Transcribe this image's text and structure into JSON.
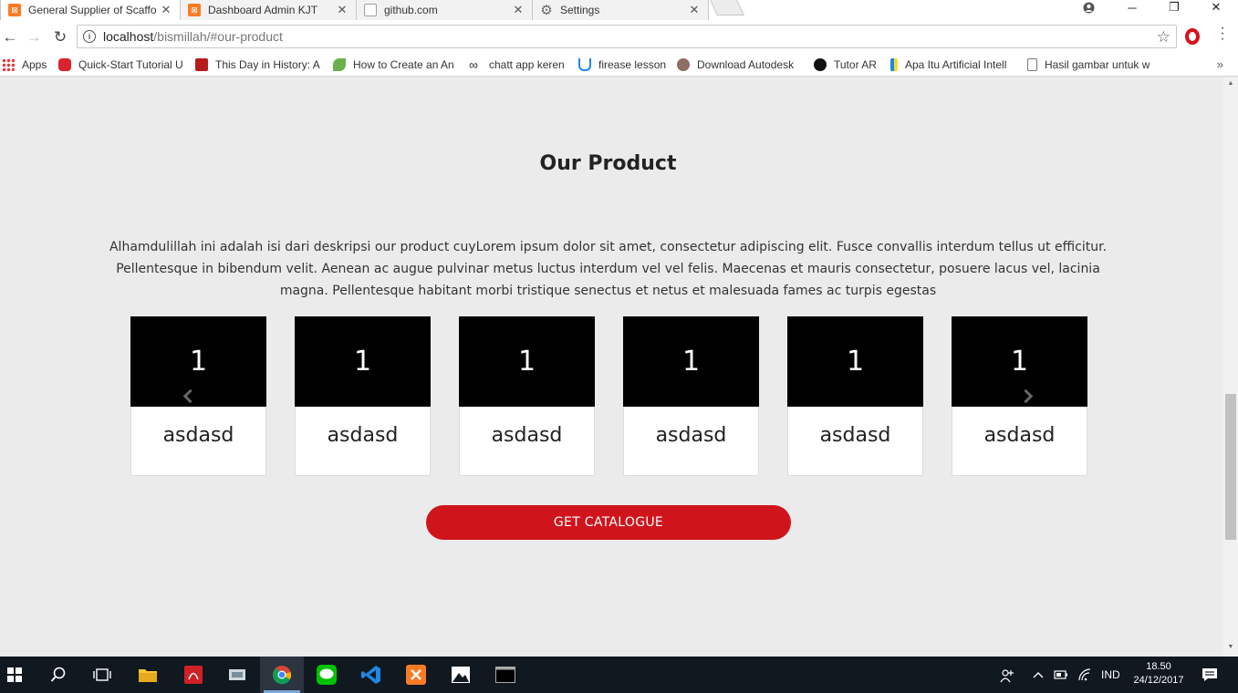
{
  "browser": {
    "tabs": [
      {
        "title": "General Supplier of Scaffo",
        "icon": "xampp-icon",
        "color": "#fb7a24",
        "active": true
      },
      {
        "title": "Dashboard Admin KJT",
        "icon": "xampp-icon",
        "color": "#fb7a24",
        "active": false
      },
      {
        "title": "github.com",
        "icon": "page-icon",
        "color": "#9e9e9e",
        "active": false
      },
      {
        "title": "Settings",
        "icon": "gear-icon",
        "color": "#666666",
        "active": false
      }
    ],
    "address": {
      "host": "localhost",
      "path": "/bismillah/#our-product"
    },
    "bookmarks": [
      {
        "label": "Apps",
        "icon": "apps-grid-icon"
      },
      {
        "label": "Quick-Start Tutorial U",
        "icon": "oracle-icon"
      },
      {
        "label": "This Day in History: A",
        "icon": "history-icon"
      },
      {
        "label": "How to Create an An",
        "icon": "leaf-icon"
      },
      {
        "label": "chatt app keren",
        "icon": "infinity-icon"
      },
      {
        "label": "firease lesson",
        "icon": "udemy-icon"
      },
      {
        "label": "Download Autodesk",
        "icon": "autodesk-icon"
      },
      {
        "label": "Tutor AR",
        "icon": "unity-icon"
      },
      {
        "label": "Apa Itu Artificial Intell",
        "icon": "bookmark-icon"
      },
      {
        "label": "Hasil gambar untuk w",
        "icon": "page-icon"
      }
    ]
  },
  "page": {
    "title": "Our Product",
    "description": "Alhamdulillah ini adalah isi dari deskripsi our product cuyLorem ipsum dolor sit amet, consectetur adipiscing elit. Fusce convallis interdum tellus ut efficitur. Pellentesque in bibendum velit. Aenean ac augue pulvinar metus luctus interdum vel vel felis. Maecenas et mauris consectetur, posuere lacus vel, lacinia magna. Pellentesque habitant morbi tristique senectus et netus et malesuada fames ac turpis egestas",
    "products": [
      {
        "slide": "1",
        "name": "asdasd"
      },
      {
        "slide": "1",
        "name": "asdasd"
      },
      {
        "slide": "1",
        "name": "asdasd"
      },
      {
        "slide": "1",
        "name": "asdasd"
      },
      {
        "slide": "1",
        "name": "asdasd"
      },
      {
        "slide": "1",
        "name": "asdasd"
      }
    ],
    "cta_label": "GET CATALOGUE",
    "accent": "#d0141c"
  },
  "taskbar": {
    "language": "IND",
    "time": "18.50",
    "date": "24/12/2017"
  }
}
